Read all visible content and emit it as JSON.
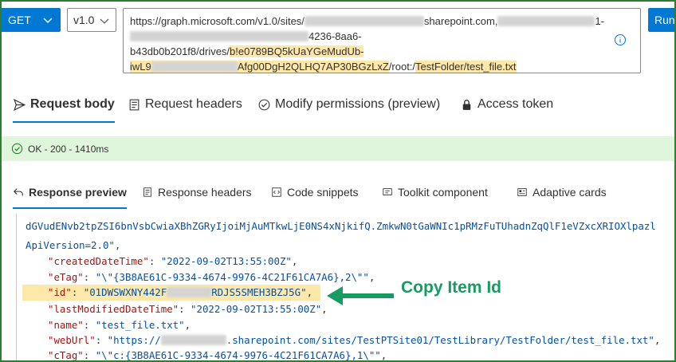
{
  "toolbar": {
    "method": "GET",
    "version": "v1.0",
    "run_label": "Run"
  },
  "url": {
    "line1_prefix": "https://graph.microsoft.com/v1.0/sites/",
    "line1_mid": "sharepoint.com,",
    "line1_tail": "1-",
    "line2_tail": "4236-8aa6-",
    "line3_plain": "b43db0b201f8/drives/",
    "line3_hl": "b!e0789BQ5kUaYGeMudUb-",
    "line4_hl_a": "iwL9",
    "line4_hl_b": "Afg00DgH2QLHQ7AP30BGzLxZ",
    "line4_plain": "/root:/",
    "line4_hl_c": "TestFolder/test_file.txt"
  },
  "request_tabs": [
    {
      "label": "Request body",
      "icon": "send-icon",
      "active": true
    },
    {
      "label": "Request headers",
      "icon": "document-icon",
      "active": false
    },
    {
      "label": "Modify permissions (preview)",
      "icon": "shield-check-icon",
      "active": false
    },
    {
      "label": "Access token",
      "icon": "lock-icon",
      "active": false
    }
  ],
  "status": {
    "text": "OK - 200 - 1410ms",
    "color": "#dff6dd"
  },
  "response_tabs": [
    {
      "label": "Response preview",
      "icon": "back-arrow-icon",
      "active": true
    },
    {
      "label": "Response headers",
      "icon": "document-icon",
      "active": false
    },
    {
      "label": "Code snippets",
      "icon": "code-icon",
      "active": false
    },
    {
      "label": "Toolkit component",
      "icon": "toolkit-icon",
      "active": false
    },
    {
      "label": "Adaptive cards",
      "icon": "card-icon",
      "active": false
    }
  ],
  "response": {
    "wrap_line1": "dGVudENvb2tpZSI6bnVsbCwiaXBhZGRyIjoiMjAuMTkwLjE0NS4xNjkifQ.ZmkwN0tGaWNIc1pRMzFuTUhadnZqQlF1eVZxcXRIOXlpazl",
    "wrap_line2": "ApiVersion=2.0\",",
    "created_key": "\"createdDateTime\"",
    "created_val": "\"2022-09-02T13:55:00Z\"",
    "etag_key": "\"eTag\"",
    "etag_val": "\"\\\"{3B8AE61C-9334-4674-9976-4C21F61CA7A6},2\\\"\"",
    "id_key": "\"id\"",
    "id_val_a": "\"01DWSWXNY442F",
    "id_val_b": "RDJS5SMEH3BZJ5G\"",
    "modified_key": "\"lastModifiedDateTime\"",
    "modified_val": "\"2022-09-02T13:55:00Z\"",
    "name_key": "\"name\"",
    "name_val": "\"test_file.txt\"",
    "weburl_key": "\"webUrl\"",
    "weburl_val_a": "\"https://",
    "weburl_val_b": ".sharepoint.com/sites/TestPTSite01/TestLibrary/TestFolder/test_file.txt\"",
    "ctag_key": "\"cTag\"",
    "ctag_val": "\"\\\"c:{3B8AE61C-9334-4674-9976-4C21F61CA7A6},1\\\"\""
  },
  "annotation": {
    "callout": "Copy Item Id",
    "color": "#169b62"
  }
}
